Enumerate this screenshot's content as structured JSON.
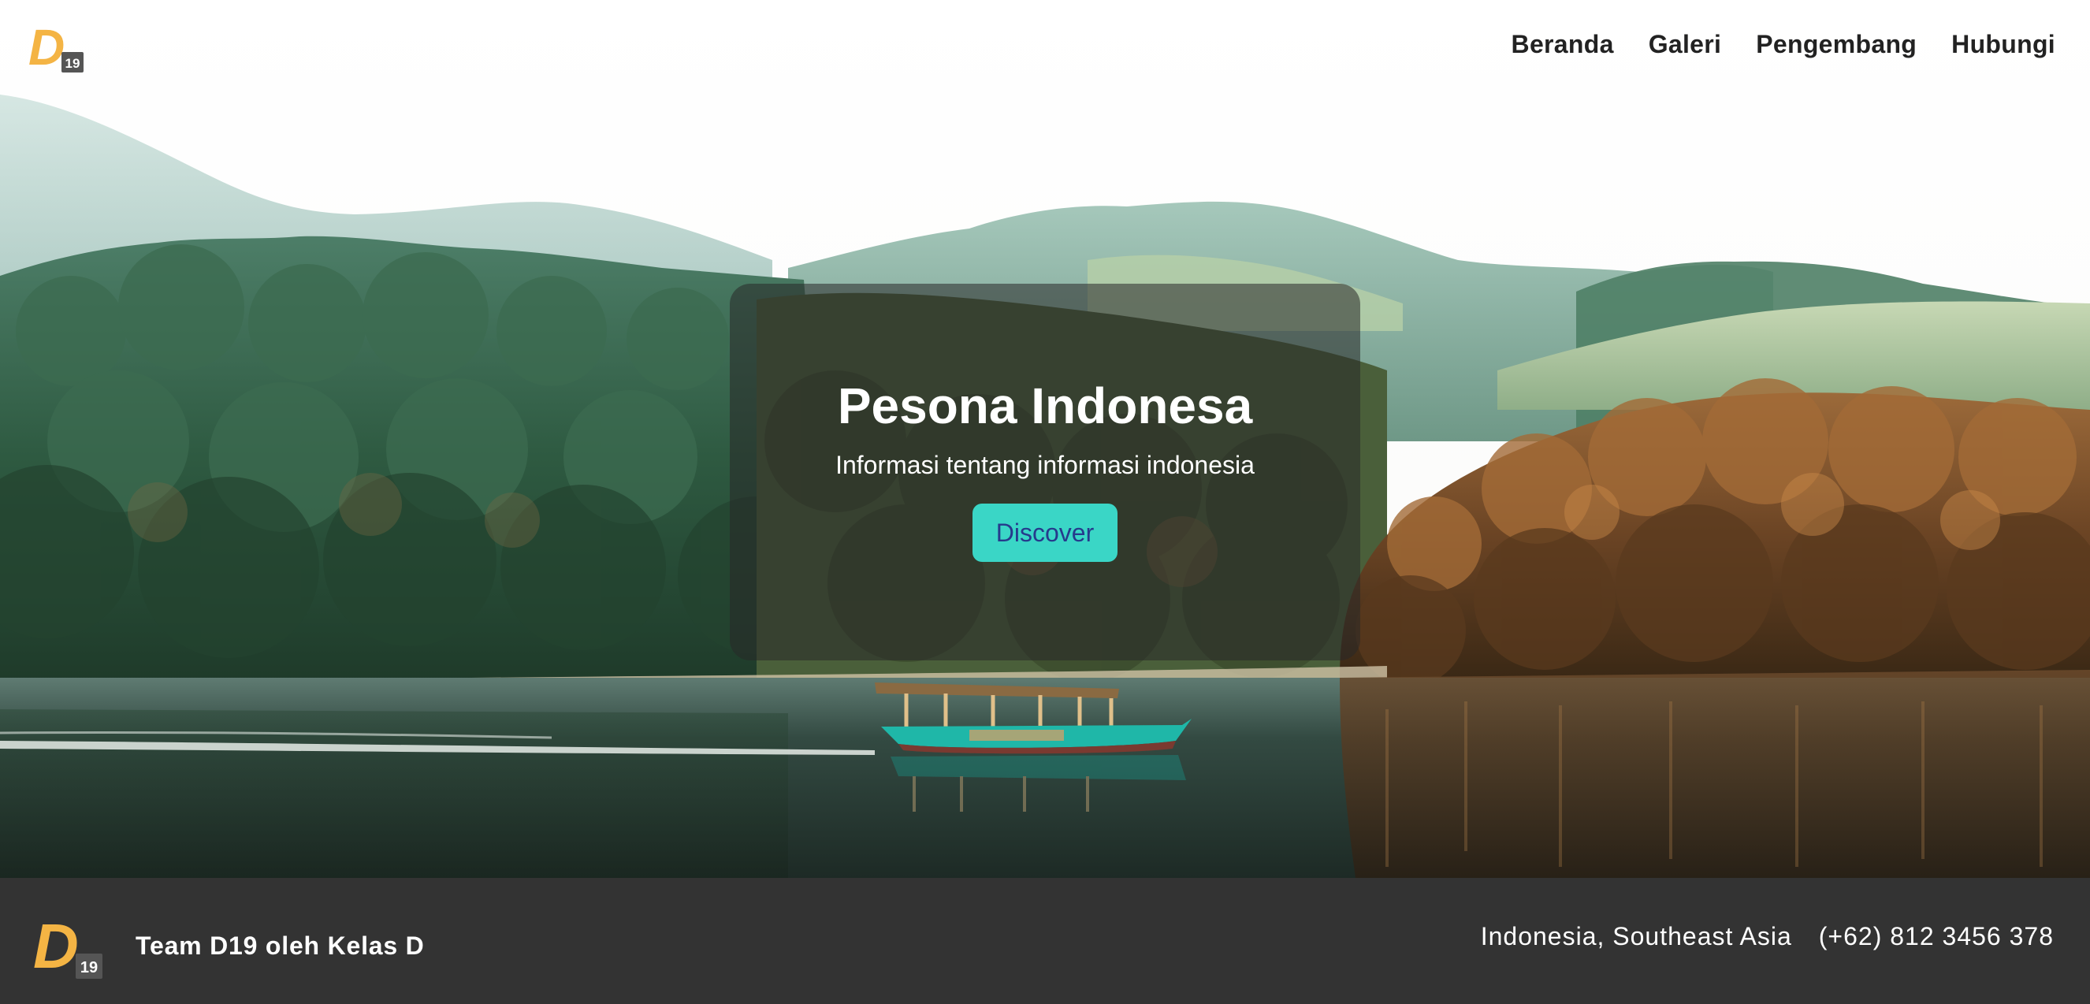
{
  "header": {
    "logo": {
      "letter": "D",
      "badge": "19",
      "letter_color": "#f4b444",
      "badge_color": "#555555"
    },
    "nav": [
      {
        "label": "Beranda"
      },
      {
        "label": "Galeri"
      },
      {
        "label": "Pengembang"
      },
      {
        "label": "Hubungi"
      }
    ]
  },
  "hero": {
    "title": "Pesona Indonesa",
    "subtitle": "Informasi tentang informasi indonesia",
    "button_label": "Discover",
    "button_color": "#3ad6c6",
    "card_overlay": "rgba(40,40,40,0.55)",
    "background": "lake with wooden boat, forested hills and misty mountains"
  },
  "footer": {
    "logo": {
      "letter": "D",
      "badge": "19"
    },
    "team": "Team D19 oleh Kelas D",
    "location": "Indonesia, Southeast Asia",
    "phone": "(+62) 812 3456 378",
    "background_color": "#333333"
  }
}
